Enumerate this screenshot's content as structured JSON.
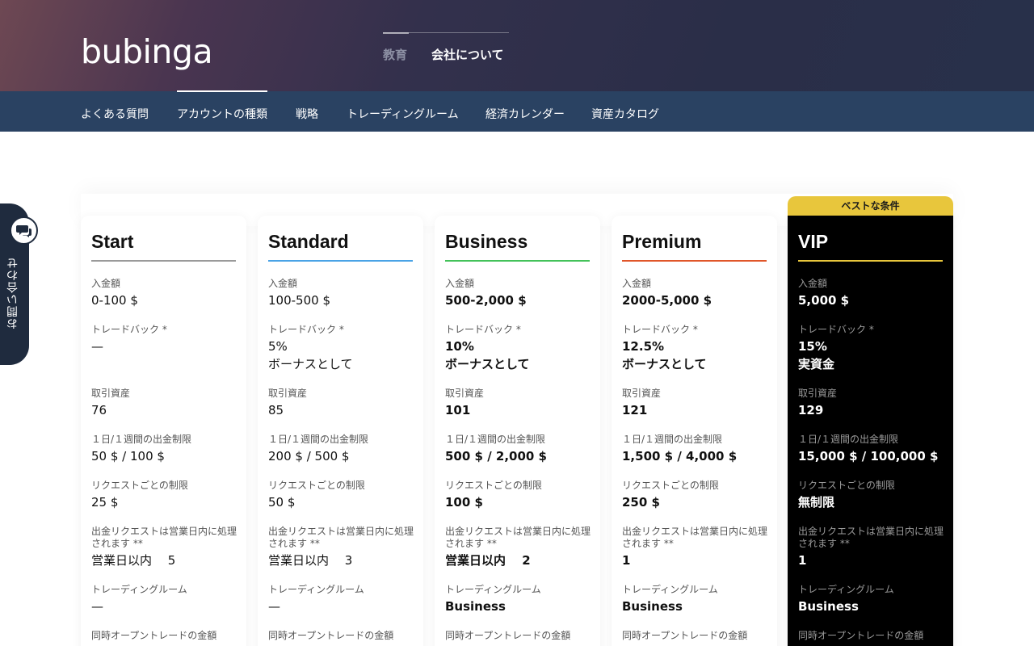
{
  "header": {
    "logo": "bubinga",
    "nav": [
      {
        "label": "教育"
      },
      {
        "label": "会社について"
      }
    ]
  },
  "subnav": [
    {
      "label": "よくある質問"
    },
    {
      "label": "アカウントの種類"
    },
    {
      "label": "戦略"
    },
    {
      "label": "トレーディングルーム"
    },
    {
      "label": "経済カレンダー"
    },
    {
      "label": "資産カタログ"
    }
  ],
  "contact": {
    "label": "お問い合わせ",
    "icon": "chat-bubble-icon"
  },
  "labels": {
    "deposit": "入金額",
    "tradeback": "トレードバック *",
    "assets": "取引資産",
    "withdraw_limit": "１日/１週間の出金制限",
    "per_request": "リクエストごとの制限",
    "processing": "出金リクエストは営業日内に処理されます **",
    "trading_room": "トレーディングルーム",
    "simultaneous": "同時オープントレードの金額"
  },
  "vip_badge": "ベストな条件",
  "accounts": [
    {
      "name": "Start",
      "rule_color": "#9a9a9a",
      "deposit": "0-100 $",
      "tradeback_line1": "—",
      "tradeback_line2": "",
      "assets": "76",
      "withdraw_limit": "50 $ / 100 $",
      "per_request": "25 $",
      "processing": "営業日以内　 5",
      "trading_room": "—"
    },
    {
      "name": "Standard",
      "rule_color": "#4aa3e6",
      "deposit": "100-500 $",
      "tradeback_line1": "5%",
      "tradeback_line2": "ボーナスとして",
      "assets": "85",
      "withdraw_limit": "200 $ / 500 $",
      "per_request": "50 $",
      "processing": "営業日以内　 3",
      "trading_room": "—"
    },
    {
      "name": "Business",
      "rule_color": "#44c25a",
      "deposit": "500-2,000 $",
      "tradeback_line1": "10%",
      "tradeback_line2": "ボーナスとして",
      "assets": "101",
      "withdraw_limit": "500 $ / 2,000 $",
      "per_request": "100 $",
      "processing": "営業日以内　 2",
      "trading_room": "Business"
    },
    {
      "name": "Premium",
      "rule_color": "#e0562a",
      "deposit": "2000-5,000 $",
      "tradeback_line1": "12.5%",
      "tradeback_line2": "ボーナスとして",
      "assets": "121",
      "withdraw_limit": "1,500 $ / 4,000 $",
      "per_request": "250 $",
      "processing": "1",
      "trading_room": "Business"
    },
    {
      "name": "VIP",
      "rule_color": "#e8c63c",
      "deposit": "5,000 $",
      "tradeback_line1": "15%",
      "tradeback_line2": "実資金",
      "assets": "129",
      "withdraw_limit": "15,000 $ / 100,000 $",
      "per_request": "無制限",
      "processing": "1",
      "trading_room": "Business"
    }
  ]
}
